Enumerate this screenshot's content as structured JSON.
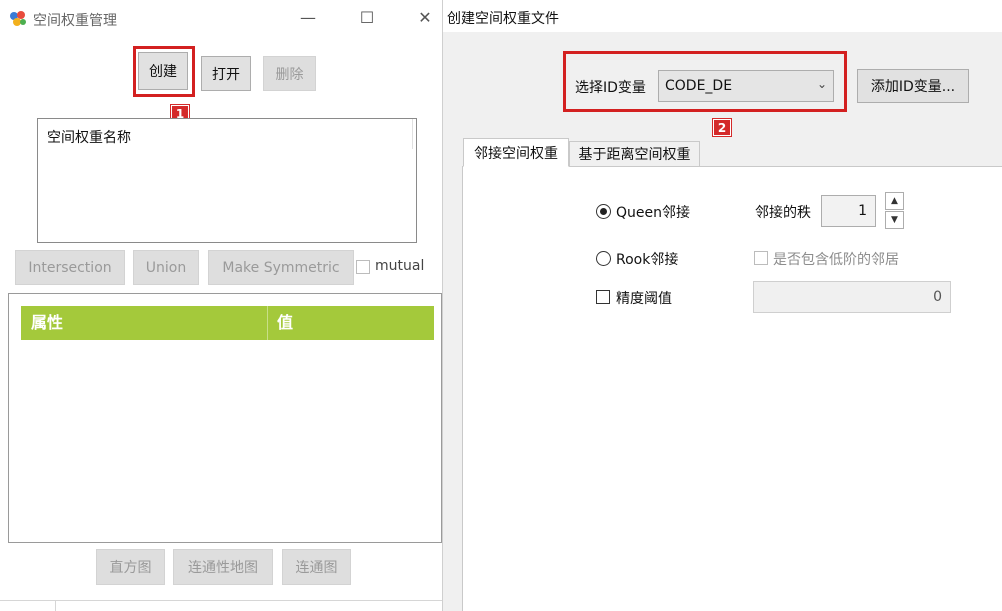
{
  "left_window": {
    "title": "空间权重管理",
    "controls": {
      "minimize": "—",
      "maximize": "☐",
      "close": "✕"
    },
    "buttons": {
      "create": "创建",
      "open": "打开",
      "delete": "删除"
    },
    "badge_1": "1",
    "list_header": "空间权重名称",
    "ops": {
      "intersection": "Intersection",
      "union": "Union",
      "make_symmetric": "Make Symmetric",
      "mutual": "mutual"
    },
    "table": {
      "col_attr": "属性",
      "col_value": "值"
    },
    "bottom_buttons": {
      "histogram": "直方图",
      "connectivity_map": "连通性地图",
      "connectivity_graph": "连通图"
    }
  },
  "right_window": {
    "title": "创建空间权重文件",
    "select_id_label": "选择ID变量",
    "select_id_value": "CODE_DE",
    "add_id_button": "添加ID变量...",
    "badge_2": "2",
    "tabs": {
      "contiguity": "邻接空间权重",
      "distance": "基于距离空间权重"
    },
    "queen_label": "Queen邻接",
    "rook_label": "Rook邻接",
    "order_label": "邻接的秩",
    "order_value": "1",
    "include_lower_label": "是否包含低阶的邻居",
    "precision_label": "精度阈值",
    "precision_value": "0"
  },
  "colors": {
    "highlight": "#d32020",
    "table_header": "#a4c93b"
  }
}
